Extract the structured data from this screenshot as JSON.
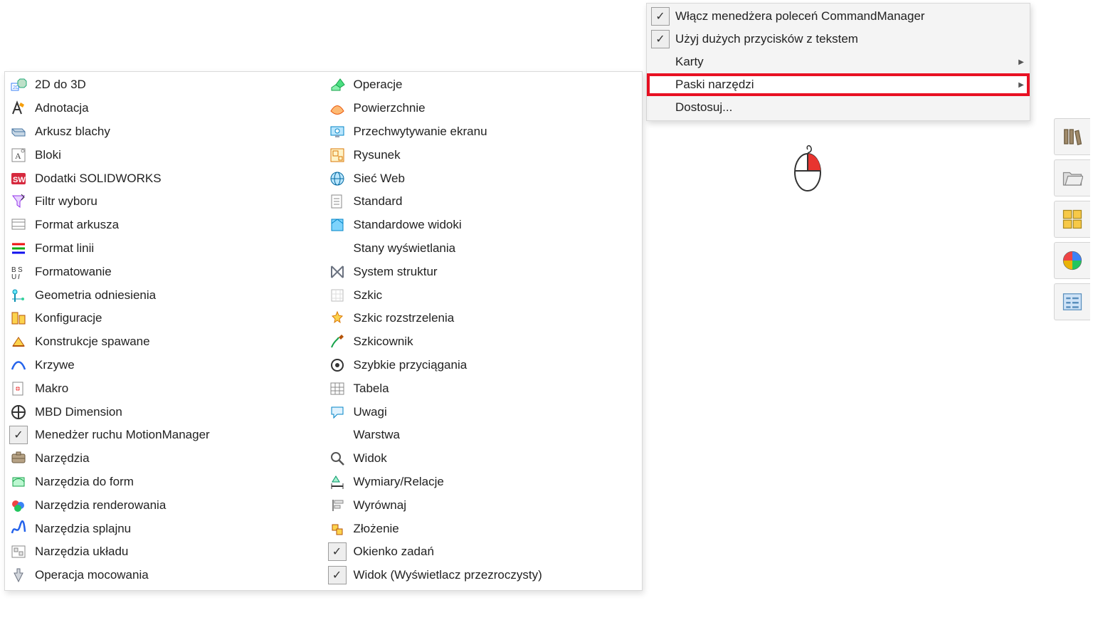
{
  "context_menu": {
    "items": [
      {
        "label": "Włącz menedżera poleceń CommandManager",
        "checked": true,
        "submenu": false,
        "highlight": false
      },
      {
        "label": "Użyj dużych przycisków z tekstem",
        "checked": true,
        "submenu": false,
        "highlight": false
      },
      {
        "label": "Karty",
        "checked": false,
        "submenu": true,
        "highlight": false
      },
      {
        "label": "Paski narzędzi",
        "checked": false,
        "submenu": true,
        "highlight": true
      },
      {
        "label": "Dostosuj...",
        "checked": false,
        "submenu": false,
        "highlight": false
      }
    ]
  },
  "submenu_columns": [
    [
      {
        "label": "2D do 3D",
        "icon": "cube-2d3d",
        "checked": null
      },
      {
        "label": "Adnotacja",
        "icon": "annotation",
        "checked": null
      },
      {
        "label": "Arkusz blachy",
        "icon": "sheetmetal",
        "checked": null
      },
      {
        "label": "Bloki",
        "icon": "blocks",
        "checked": null
      },
      {
        "label": "Dodatki SOLIDWORKS",
        "icon": "sw-logo",
        "checked": null
      },
      {
        "label": "Filtr wyboru",
        "icon": "filter",
        "checked": null
      },
      {
        "label": "Format arkusza",
        "icon": "sheet-format",
        "checked": null
      },
      {
        "label": "Format linii",
        "icon": "line-format",
        "checked": null
      },
      {
        "label": "Formatowanie",
        "icon": "formatting",
        "checked": null
      },
      {
        "label": "Geometria odniesienia",
        "icon": "ref-geom",
        "checked": null
      },
      {
        "label": "Konfiguracje",
        "icon": "configurations",
        "checked": null
      },
      {
        "label": "Konstrukcje spawane",
        "icon": "weldments",
        "checked": null
      },
      {
        "label": "Krzywe",
        "icon": "curves",
        "checked": null
      },
      {
        "label": "Makro",
        "icon": "macro",
        "checked": null
      },
      {
        "label": "MBD Dimension",
        "icon": "mbd",
        "checked": null
      },
      {
        "label": "Menedżer ruchu MotionManager",
        "icon": null,
        "checked": true
      },
      {
        "label": "Narzędzia",
        "icon": "tools",
        "checked": null
      },
      {
        "label": "Narzędzia do form",
        "icon": "mold-tools",
        "checked": null
      },
      {
        "label": "Narzędzia renderowania",
        "icon": "render-tools",
        "checked": null
      },
      {
        "label": "Narzędzia splajnu",
        "icon": "spline-tools",
        "checked": null
      },
      {
        "label": "Narzędzia układu",
        "icon": "layout-tools",
        "checked": null
      },
      {
        "label": "Operacja mocowania",
        "icon": "fastening",
        "checked": null
      }
    ],
    [
      {
        "label": "Operacje",
        "icon": "features",
        "checked": null
      },
      {
        "label": "Powierzchnie",
        "icon": "surfaces",
        "checked": null
      },
      {
        "label": "Przechwytywanie ekranu",
        "icon": "screen-capture",
        "checked": null
      },
      {
        "label": "Rysunek",
        "icon": "drawing",
        "checked": null
      },
      {
        "label": "Sieć Web",
        "icon": "web",
        "checked": null
      },
      {
        "label": "Standard",
        "icon": "standard",
        "checked": null
      },
      {
        "label": "Standardowe widoki",
        "icon": "std-views",
        "checked": null
      },
      {
        "label": "Stany wyświetlania",
        "icon": null,
        "checked": null
      },
      {
        "label": "System struktur",
        "icon": "structure",
        "checked": null
      },
      {
        "label": "Szkic",
        "icon": "sketch",
        "checked": null
      },
      {
        "label": "Szkic rozstrzelenia",
        "icon": "explode-sketch",
        "checked": null
      },
      {
        "label": "Szkicownik",
        "icon": "sketcher",
        "checked": null
      },
      {
        "label": "Szybkie przyciągania",
        "icon": "quick-snaps",
        "checked": null
      },
      {
        "label": "Tabela",
        "icon": "table",
        "checked": null
      },
      {
        "label": "Uwagi",
        "icon": "comments",
        "checked": null
      },
      {
        "label": "Warstwa",
        "icon": null,
        "checked": null
      },
      {
        "label": "Widok",
        "icon": "view",
        "checked": null
      },
      {
        "label": "Wymiary/Relacje",
        "icon": "dim-rel",
        "checked": null
      },
      {
        "label": "Wyrównaj",
        "icon": "align",
        "checked": null
      },
      {
        "label": "Złożenie",
        "icon": "assembly",
        "checked": null
      },
      {
        "label": "Okienko zadań",
        "icon": null,
        "checked": true
      },
      {
        "label": "Widok (Wyświetlacz przezroczysty)",
        "icon": null,
        "checked": true
      }
    ]
  ],
  "task_pane_buttons": [
    "library-icon",
    "open-folder-icon",
    "view-palette-icon",
    "appearances-icon",
    "properties-icon"
  ]
}
